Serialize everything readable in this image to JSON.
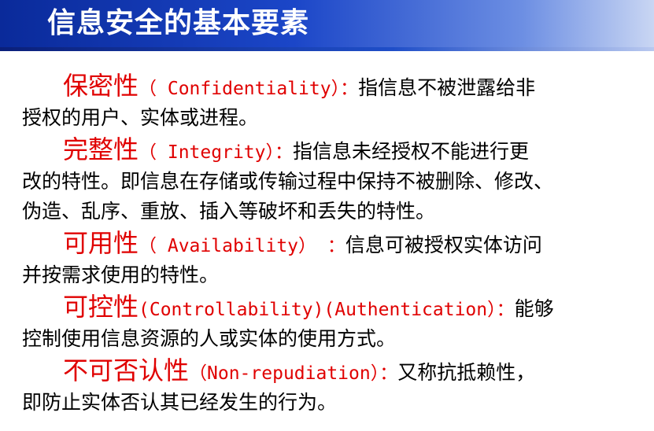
{
  "slide": {
    "title": "信息安全的基本要素"
  },
  "items": [
    {
      "term": "保密性",
      "english": "（ Confidentiality）：",
      "desc_first": "指信息不被泄露给非",
      "lines": [
        "授权的用户、实体或进程。"
      ]
    },
    {
      "term": "完整性",
      "english": "（ Integrity）：",
      "desc_first": "指信息未经授权不能进行更",
      "lines": [
        "改的特性。即信息在存储或传输过程中保持不被删除、修改、",
        "伪造、乱序、重放、插入等破坏和丢失的特性。"
      ]
    },
    {
      "term": "可用性",
      "english": "（ Availability） ：",
      "desc_first": "信息可被授权实体访问",
      "lines": [
        "并按需求使用的特性。"
      ]
    },
    {
      "term": "可控性",
      "english": "(Controllability)(Authentication）：",
      "desc_first": "能够",
      "lines": [
        "控制使用信息资源的人或实体的使用方式。"
      ]
    },
    {
      "term": "不可否认性",
      "english": "（Non-repudiation）：",
      "desc_first": "又称抗抵赖性，",
      "lines": [
        "即防止实体否认其已经发生的行为。"
      ]
    }
  ]
}
